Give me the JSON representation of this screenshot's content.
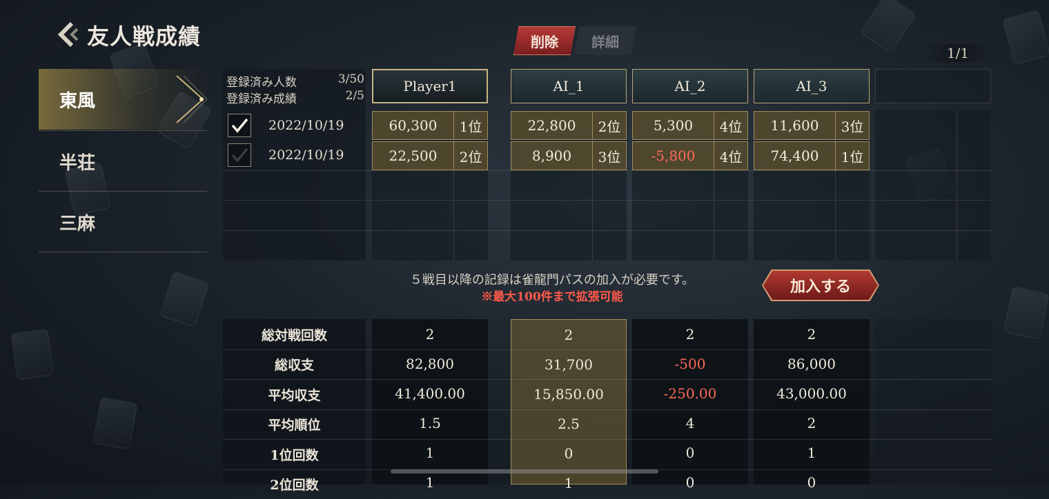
{
  "header": {
    "title": "友人戦成績",
    "tabs": [
      "削除",
      "詳細"
    ],
    "page_indicator": "1/1"
  },
  "sidebar": {
    "items": [
      {
        "label": "東風",
        "selected": true
      },
      {
        "label": "半荘",
        "selected": false
      },
      {
        "label": "三麻",
        "selected": false
      }
    ]
  },
  "registration": {
    "players_label": "登録済み人数",
    "players_value": "3/50",
    "records_label": "登録済み成績",
    "records_value": "2/5"
  },
  "players": [
    "Player1",
    "AI_1",
    "AI_2",
    "AI_3"
  ],
  "games": [
    {
      "checked": true,
      "date": "2022/10/19",
      "results": [
        {
          "score": "60,300",
          "rank": "1位"
        },
        {
          "score": "22,800",
          "rank": "2位"
        },
        {
          "score": "5,300",
          "rank": "4位"
        },
        {
          "score": "11,600",
          "rank": "3位"
        }
      ]
    },
    {
      "checked": false,
      "date": "2022/10/19",
      "results": [
        {
          "score": "22,500",
          "rank": "2位"
        },
        {
          "score": "8,900",
          "rank": "3位"
        },
        {
          "score": "-5,800",
          "rank": "4位"
        },
        {
          "score": "74,400",
          "rank": "1位"
        }
      ]
    }
  ],
  "notice": {
    "text": "５戦目以降の記録は雀龍門パスの加入が必要です。",
    "sub": "※最大100件まで拡張可能",
    "join_button": "加入する"
  },
  "stats": {
    "labels": [
      "総対戦回数",
      "総収支",
      "平均収支",
      "平均順位",
      "1位回数",
      "2位回数"
    ],
    "columns": [
      [
        "2",
        "82,800",
        "41,400.00",
        "1.5",
        "1",
        "1"
      ],
      [
        "2",
        "31,700",
        "15,850.00",
        "2.5",
        "0",
        "1"
      ],
      [
        "2",
        "-500",
        "-250.00",
        "4",
        "0",
        "0"
      ],
      [
        "2",
        "86,000",
        "43,000.00",
        "2",
        "1",
        "0"
      ]
    ]
  },
  "colors": {
    "accent_red": "#b43a38",
    "gold": "#b8a77a",
    "negative": "#ff6a5a"
  }
}
